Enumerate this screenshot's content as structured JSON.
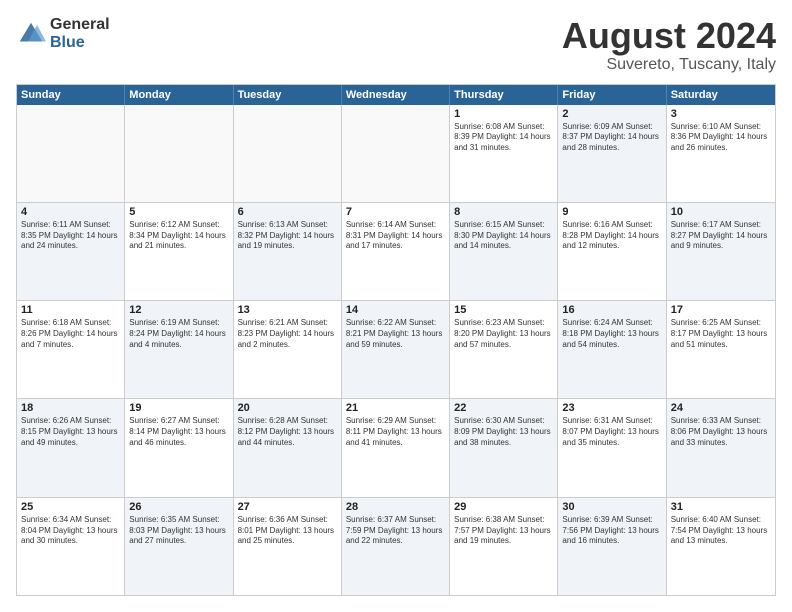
{
  "logo": {
    "general": "General",
    "blue": "Blue"
  },
  "title": "August 2024",
  "subtitle": "Suvereto, Tuscany, Italy",
  "header_days": [
    "Sunday",
    "Monday",
    "Tuesday",
    "Wednesday",
    "Thursday",
    "Friday",
    "Saturday"
  ],
  "weeks": [
    [
      {
        "day": "",
        "info": "",
        "shaded": false,
        "empty": true
      },
      {
        "day": "",
        "info": "",
        "shaded": false,
        "empty": true
      },
      {
        "day": "",
        "info": "",
        "shaded": false,
        "empty": true
      },
      {
        "day": "",
        "info": "",
        "shaded": false,
        "empty": true
      },
      {
        "day": "1",
        "info": "Sunrise: 6:08 AM\nSunset: 8:39 PM\nDaylight: 14 hours\nand 31 minutes.",
        "shaded": false,
        "empty": false
      },
      {
        "day": "2",
        "info": "Sunrise: 6:09 AM\nSunset: 8:37 PM\nDaylight: 14 hours\nand 28 minutes.",
        "shaded": true,
        "empty": false
      },
      {
        "day": "3",
        "info": "Sunrise: 6:10 AM\nSunset: 8:36 PM\nDaylight: 14 hours\nand 26 minutes.",
        "shaded": false,
        "empty": false
      }
    ],
    [
      {
        "day": "4",
        "info": "Sunrise: 6:11 AM\nSunset: 8:35 PM\nDaylight: 14 hours\nand 24 minutes.",
        "shaded": true,
        "empty": false
      },
      {
        "day": "5",
        "info": "Sunrise: 6:12 AM\nSunset: 8:34 PM\nDaylight: 14 hours\nand 21 minutes.",
        "shaded": false,
        "empty": false
      },
      {
        "day": "6",
        "info": "Sunrise: 6:13 AM\nSunset: 8:32 PM\nDaylight: 14 hours\nand 19 minutes.",
        "shaded": true,
        "empty": false
      },
      {
        "day": "7",
        "info": "Sunrise: 6:14 AM\nSunset: 8:31 PM\nDaylight: 14 hours\nand 17 minutes.",
        "shaded": false,
        "empty": false
      },
      {
        "day": "8",
        "info": "Sunrise: 6:15 AM\nSunset: 8:30 PM\nDaylight: 14 hours\nand 14 minutes.",
        "shaded": true,
        "empty": false
      },
      {
        "day": "9",
        "info": "Sunrise: 6:16 AM\nSunset: 8:28 PM\nDaylight: 14 hours\nand 12 minutes.",
        "shaded": false,
        "empty": false
      },
      {
        "day": "10",
        "info": "Sunrise: 6:17 AM\nSunset: 8:27 PM\nDaylight: 14 hours\nand 9 minutes.",
        "shaded": true,
        "empty": false
      }
    ],
    [
      {
        "day": "11",
        "info": "Sunrise: 6:18 AM\nSunset: 8:26 PM\nDaylight: 14 hours\nand 7 minutes.",
        "shaded": false,
        "empty": false
      },
      {
        "day": "12",
        "info": "Sunrise: 6:19 AM\nSunset: 8:24 PM\nDaylight: 14 hours\nand 4 minutes.",
        "shaded": true,
        "empty": false
      },
      {
        "day": "13",
        "info": "Sunrise: 6:21 AM\nSunset: 8:23 PM\nDaylight: 14 hours\nand 2 minutes.",
        "shaded": false,
        "empty": false
      },
      {
        "day": "14",
        "info": "Sunrise: 6:22 AM\nSunset: 8:21 PM\nDaylight: 13 hours\nand 59 minutes.",
        "shaded": true,
        "empty": false
      },
      {
        "day": "15",
        "info": "Sunrise: 6:23 AM\nSunset: 8:20 PM\nDaylight: 13 hours\nand 57 minutes.",
        "shaded": false,
        "empty": false
      },
      {
        "day": "16",
        "info": "Sunrise: 6:24 AM\nSunset: 8:18 PM\nDaylight: 13 hours\nand 54 minutes.",
        "shaded": true,
        "empty": false
      },
      {
        "day": "17",
        "info": "Sunrise: 6:25 AM\nSunset: 8:17 PM\nDaylight: 13 hours\nand 51 minutes.",
        "shaded": false,
        "empty": false
      }
    ],
    [
      {
        "day": "18",
        "info": "Sunrise: 6:26 AM\nSunset: 8:15 PM\nDaylight: 13 hours\nand 49 minutes.",
        "shaded": true,
        "empty": false
      },
      {
        "day": "19",
        "info": "Sunrise: 6:27 AM\nSunset: 8:14 PM\nDaylight: 13 hours\nand 46 minutes.",
        "shaded": false,
        "empty": false
      },
      {
        "day": "20",
        "info": "Sunrise: 6:28 AM\nSunset: 8:12 PM\nDaylight: 13 hours\nand 44 minutes.",
        "shaded": true,
        "empty": false
      },
      {
        "day": "21",
        "info": "Sunrise: 6:29 AM\nSunset: 8:11 PM\nDaylight: 13 hours\nand 41 minutes.",
        "shaded": false,
        "empty": false
      },
      {
        "day": "22",
        "info": "Sunrise: 6:30 AM\nSunset: 8:09 PM\nDaylight: 13 hours\nand 38 minutes.",
        "shaded": true,
        "empty": false
      },
      {
        "day": "23",
        "info": "Sunrise: 6:31 AM\nSunset: 8:07 PM\nDaylight: 13 hours\nand 35 minutes.",
        "shaded": false,
        "empty": false
      },
      {
        "day": "24",
        "info": "Sunrise: 6:33 AM\nSunset: 8:06 PM\nDaylight: 13 hours\nand 33 minutes.",
        "shaded": true,
        "empty": false
      }
    ],
    [
      {
        "day": "25",
        "info": "Sunrise: 6:34 AM\nSunset: 8:04 PM\nDaylight: 13 hours\nand 30 minutes.",
        "shaded": false,
        "empty": false
      },
      {
        "day": "26",
        "info": "Sunrise: 6:35 AM\nSunset: 8:03 PM\nDaylight: 13 hours\nand 27 minutes.",
        "shaded": true,
        "empty": false
      },
      {
        "day": "27",
        "info": "Sunrise: 6:36 AM\nSunset: 8:01 PM\nDaylight: 13 hours\nand 25 minutes.",
        "shaded": false,
        "empty": false
      },
      {
        "day": "28",
        "info": "Sunrise: 6:37 AM\nSunset: 7:59 PM\nDaylight: 13 hours\nand 22 minutes.",
        "shaded": true,
        "empty": false
      },
      {
        "day": "29",
        "info": "Sunrise: 6:38 AM\nSunset: 7:57 PM\nDaylight: 13 hours\nand 19 minutes.",
        "shaded": false,
        "empty": false
      },
      {
        "day": "30",
        "info": "Sunrise: 6:39 AM\nSunset: 7:56 PM\nDaylight: 13 hours\nand 16 minutes.",
        "shaded": true,
        "empty": false
      },
      {
        "day": "31",
        "info": "Sunrise: 6:40 AM\nSunset: 7:54 PM\nDaylight: 13 hours\nand 13 minutes.",
        "shaded": false,
        "empty": false
      }
    ]
  ]
}
